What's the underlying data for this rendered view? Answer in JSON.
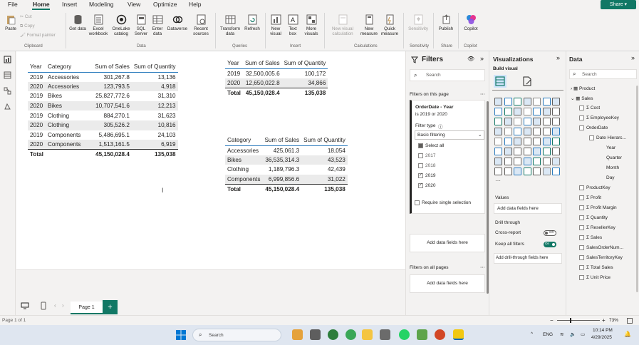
{
  "menu": {
    "items": [
      "File",
      "Home",
      "Insert",
      "Modeling",
      "View",
      "Optimize",
      "Help"
    ],
    "share": "Share"
  },
  "ribbon": {
    "paste": "Paste",
    "cut": "Cut",
    "copy": "Copy",
    "format_painter": "Format painter",
    "clipboard_group": "Clipboard",
    "get_data": "Get data",
    "excel_workbook": "Excel workbook",
    "onelake_catalog": "OneLake catalog",
    "sql_server": "SQL Server",
    "enter_data": "Enter data",
    "dataverse": "Dataverse",
    "recent_sources": "Recent sources",
    "data_group": "Data",
    "transform_data": "Transform data",
    "refresh": "Refresh",
    "queries_group": "Queries",
    "new_visual": "New visual",
    "text_box": "Text box",
    "more_visuals": "More visuals",
    "insert_group": "Insert",
    "new_visual_calculation": "New visual calculation",
    "new_measure": "New measure",
    "quick_measure": "Quick measure",
    "calculations_group": "Calculations",
    "sensitivity": "Sensitivity",
    "sensitivity_group": "Sensitivity",
    "publish": "Publish",
    "share_group": "Share",
    "copilot": "Copilot",
    "copilot_group": "Copilot"
  },
  "table1": {
    "headers": [
      "Year",
      "Category",
      "Sum of Sales",
      "Sum of Quantity"
    ],
    "rows": [
      [
        "2019",
        "Accessories",
        "301,267.8",
        "13,136"
      ],
      [
        "2020",
        "Accessories",
        "123,793.5",
        "4,918"
      ],
      [
        "2019",
        "Bikes",
        "25,827,772.6",
        "31,310"
      ],
      [
        "2020",
        "Bikes",
        "10,707,541.6",
        "12,213"
      ],
      [
        "2019",
        "Clothing",
        "884,270.1",
        "31,623"
      ],
      [
        "2020",
        "Clothing",
        "305,526.2",
        "10,816"
      ],
      [
        "2019",
        "Components",
        "5,486,695.1",
        "24,103"
      ],
      [
        "2020",
        "Components",
        "1,513,161.5",
        "6,919"
      ]
    ],
    "total": [
      "Total",
      "",
      "45,150,028.4",
      "135,038"
    ]
  },
  "table2": {
    "headers": [
      "Year",
      "Sum of Sales",
      "Sum of Quantity"
    ],
    "rows": [
      [
        "2019",
        "32,500,005.6",
        "100,172"
      ],
      [
        "2020",
        "12,650,022.8",
        "34,866"
      ]
    ],
    "total": [
      "Total",
      "45,150,028.4",
      "135,038"
    ]
  },
  "table3": {
    "headers": [
      "Category",
      "Sum of Sales",
      "Sum of Quantity"
    ],
    "rows": [
      [
        "Accessories",
        "425,061.3",
        "18,054"
      ],
      [
        "Bikes",
        "36,535,314.3",
        "43,523"
      ],
      [
        "Clothing",
        "1,189,796.3",
        "42,439"
      ],
      [
        "Components",
        "6,999,856.6",
        "31,022"
      ]
    ],
    "total": [
      "Total",
      "45,150,028.4",
      "135,038"
    ]
  },
  "pages": {
    "tab": "Page 1",
    "add": "+"
  },
  "filters": {
    "title": "Filters",
    "search_placeholder": "Search",
    "on_this_page": "Filters on this page",
    "card_title": "OrderDate - Year",
    "card_subtitle": "is 2019 or 2020",
    "filter_type_label": "Filter type",
    "filter_type_value": "Basic filtering",
    "options": [
      "Select all",
      "2017",
      "2018",
      "2019",
      "2020"
    ],
    "require_single": "Require single selection",
    "add_data_fields": "Add data fields here",
    "on_all_pages": "Filters on all pages",
    "add_data_fields_all": "Add data fields here"
  },
  "visualizations": {
    "title": "Visualizations",
    "build_visual": "Build visual",
    "values_label": "Values",
    "values_placeholder": "Add data fields here",
    "drill_through": "Drill through",
    "cross_report": "Cross-report",
    "cross_report_state": "Off",
    "keep_all_filters": "Keep all filters",
    "keep_all_filters_state": "On",
    "add_drill_through": "Add drill-through fields here"
  },
  "data_pane": {
    "title": "Data",
    "search_placeholder": "Search",
    "tables": [
      "Product",
      "Sales"
    ],
    "fields": [
      "Cost",
      "EmployeeKey",
      "OrderDate",
      "Date Hierarc...",
      "Year",
      "Quarter",
      "Month",
      "Day",
      "ProductKey",
      "Profit",
      "Profit Margin",
      "Quantity",
      "ResellerKey",
      "Sales",
      "SalesOrderNum...",
      "SalesTerritoryKey",
      "Total Sales",
      "Unit Price"
    ]
  },
  "status": {
    "page": "Page 1 of 1",
    "zoom": "73%"
  },
  "taskbar": {
    "search_placeholder": "Search",
    "language": "ENG",
    "time": "10:14 PM",
    "date": "4/29/2025"
  },
  "colors": {
    "accent": "#117865",
    "table_rule": "#2b7bbd",
    "alt_row": "#ebebeb"
  }
}
